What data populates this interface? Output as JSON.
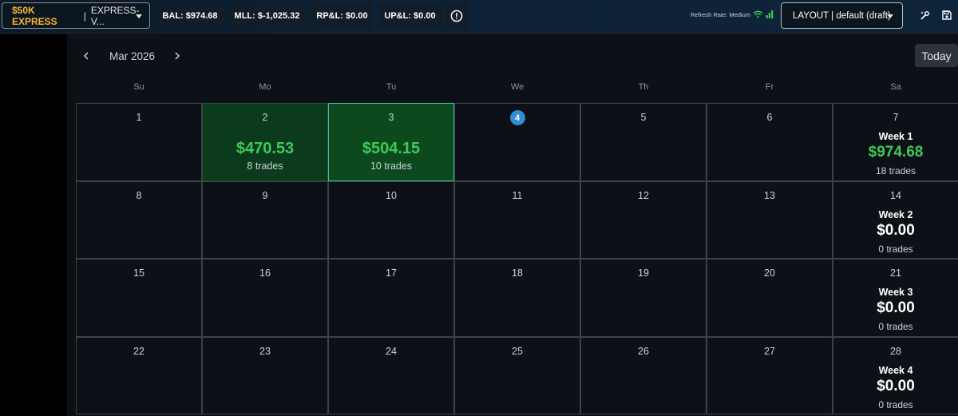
{
  "topbar": {
    "account_name": "$50K EXPRESS",
    "account_sep": "|",
    "account_id": "EXPRESS-V...",
    "bal": "BAL: $974.68",
    "mll": "MLL: $-1,025.32",
    "rpl": "RP&L: $0.00",
    "upl": "UP&L: $0.00",
    "refresh_label": "Refresh Rate: Medium",
    "layout_label": "LAYOUT | default (draft)"
  },
  "calendar": {
    "month": "Mar 2026",
    "today_label": "Today",
    "weekdays": [
      "Su",
      "Mo",
      "Tu",
      "We",
      "Th",
      "Fr",
      "Sa"
    ],
    "weeks": [
      {
        "days": [
          {
            "day": "1"
          },
          {
            "day": "2",
            "pnl": "$470.53",
            "trades": "8 trades",
            "status": "profit"
          },
          {
            "day": "3",
            "pnl": "$504.15",
            "trades": "10 trades",
            "status": "profit-selected"
          },
          {
            "day": "4",
            "is_today": true
          },
          {
            "day": "5"
          },
          {
            "day": "6"
          },
          {
            "day": "7",
            "week_label": "Week 1",
            "week_pnl": "$974.68",
            "week_trades": "18 trades",
            "week_status": "profit"
          }
        ]
      },
      {
        "days": [
          {
            "day": "8"
          },
          {
            "day": "9"
          },
          {
            "day": "10"
          },
          {
            "day": "11"
          },
          {
            "day": "12"
          },
          {
            "day": "13"
          },
          {
            "day": "14",
            "week_label": "Week 2",
            "week_pnl": "$0.00",
            "week_trades": "0 trades",
            "week_status": "flat"
          }
        ]
      },
      {
        "days": [
          {
            "day": "15"
          },
          {
            "day": "16"
          },
          {
            "day": "17"
          },
          {
            "day": "18"
          },
          {
            "day": "19"
          },
          {
            "day": "20"
          },
          {
            "day": "21",
            "week_label": "Week 3",
            "week_pnl": "$0.00",
            "week_trades": "0 trades",
            "week_status": "flat"
          }
        ]
      },
      {
        "days": [
          {
            "day": "22"
          },
          {
            "day": "23"
          },
          {
            "day": "24"
          },
          {
            "day": "25"
          },
          {
            "day": "26"
          },
          {
            "day": "27"
          },
          {
            "day": "28",
            "week_label": "Week 4",
            "week_pnl": "$0.00",
            "week_trades": "0 trades",
            "week_status": "flat"
          }
        ]
      }
    ]
  },
  "colors": {
    "accent_gold": "#f5b82e",
    "profit_green": "#3fc95a",
    "today_blue": "#2f8fd1",
    "selected_border": "#3fb9a8"
  }
}
